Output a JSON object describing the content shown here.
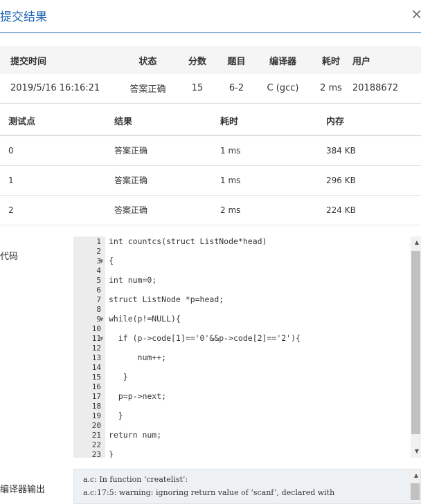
{
  "dialog": {
    "title": "提交结果",
    "close": "×"
  },
  "summary": {
    "headers": [
      "提交时间",
      "状态",
      "分数",
      "题目",
      "编译器",
      "耗时",
      "用户"
    ],
    "row": {
      "time": "2019/5/16 16:16:21",
      "status": "答案正确",
      "score": "15",
      "problem": "6-2",
      "compiler": "C (gcc)",
      "elapsed": "2 ms",
      "user": "20188672"
    }
  },
  "cases": {
    "headers": [
      "测试点",
      "结果",
      "耗时",
      "内存"
    ],
    "rows": [
      {
        "id": "0",
        "result": "答案正确",
        "time": "1 ms",
        "memory": "384 KB"
      },
      {
        "id": "1",
        "result": "答案正确",
        "time": "1 ms",
        "memory": "296 KB"
      },
      {
        "id": "2",
        "result": "答案正确",
        "time": "2 ms",
        "memory": "224 KB"
      }
    ]
  },
  "code": {
    "label": "代码",
    "line_numbers": [
      "1",
      "2",
      "3",
      "4",
      "5",
      "6",
      "7",
      "8",
      "9",
      "10",
      "11",
      "12",
      "13",
      "14",
      "15",
      "16",
      "17",
      "18",
      "19",
      "20",
      "21",
      "22",
      "23"
    ],
    "lines": [
      "int countcs(struct ListNode*head)",
      "{",
      "int num=0;",
      "struct ListNode *p=head;",
      "while(p!=NULL){",
      "  if (p->code[1]=='0'&&p->code[2]=='2'){",
      "      num++;",
      "   }",
      "  p=p->next;",
      "  }",
      "return num;",
      "}"
    ]
  },
  "compiler_output": {
    "label": "编译器输出",
    "lines": [
      "a.c: In function ‘createlist’:",
      "a.c:17:5: warning: ignoring return value of ‘scanf’, declared with"
    ]
  },
  "colors": {
    "accent": "#1f64b5",
    "accepted": "#e74c3c"
  }
}
